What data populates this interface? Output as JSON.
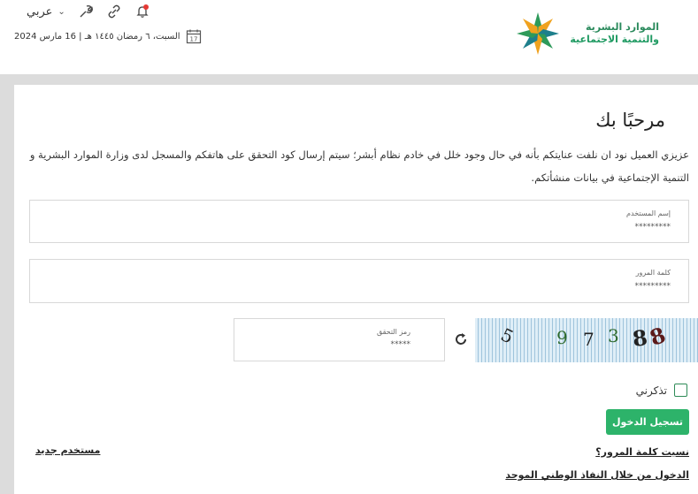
{
  "header": {
    "logo_line1": "الموارد البشرية",
    "logo_line2": "والتنمية الاجتماعية",
    "language_label": "عربي",
    "date_text": "السبت، ٦ رمضان ١٤٤٥ هـ | 16 مارس 2024",
    "calendar_day": "17",
    "icons": [
      "notification-bell-icon",
      "link-icon",
      "wrench-icon",
      "chevron-down-icon",
      "calendar-icon"
    ],
    "notification_dot_color": "#e53935"
  },
  "main": {
    "welcome": "مرحبًا بك",
    "notice": "عزيزي العميل نود ان نلفت عنايتكم بأنه في حال وجود خلل في خادم نظام أبشر؛ سيتم إرسال كود التحقق على هاتفكم والمسجل لدى وزارة الموارد البشرية و التنمية الإجتماعية في بيانات منشأتكم.",
    "username": {
      "label": "إسم المستخدم",
      "value": "*********"
    },
    "password": {
      "label": "كلمة المرور",
      "value": "*********"
    },
    "captcha_field": {
      "label": "رمز التحقق",
      "value": "*****"
    },
    "captcha_chars": [
      "8",
      "8",
      "3",
      "7",
      "9",
      "5"
    ],
    "remember_label": "تذكرني",
    "login_button": "تسجيل الدخول",
    "new_user_link": "مستخدم جديد",
    "forgot_password_link": "نسيت كلمة المرور؟",
    "nafath_link": "الدخول من خلال النفاذ الوطني الموحد",
    "accent_color": "#2db36a"
  }
}
